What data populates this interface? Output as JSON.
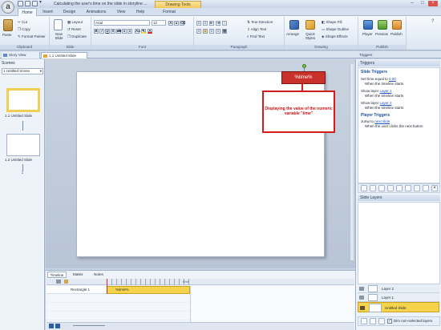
{
  "app": {
    "window_title": "Calculating the user's time on the slide in storyline ...",
    "context_tab": "Drawing Tools",
    "logo_letter": "a"
  },
  "ribbon": {
    "tabs": [
      "Home",
      "Insert",
      "Design",
      "Animations",
      "View",
      "Help",
      "Format"
    ],
    "active_tab": "Home",
    "clipboard": {
      "paste": "Paste",
      "cut": "Cut",
      "copy": "Copy",
      "format_painter": "Format Painter",
      "label": "Clipboard"
    },
    "slide": {
      "new_slide": "New Slide",
      "layout": "Layout",
      "reset": "Reset",
      "duplicate": "Duplicate",
      "label": "Slide"
    },
    "font": {
      "name": "Arial",
      "size": "12",
      "label": "Font"
    },
    "paragraph": {
      "text_direction": "Text Direction",
      "align_text": "Align Text",
      "find_text": "Find Text",
      "label": "Paragraph"
    },
    "drawing": {
      "arrange": "Arrange",
      "quick_styles": "Quick Styles",
      "shape_fill": "Shape Fill",
      "shape_outline": "Shape Outline",
      "shape_effects": "Shape Effects",
      "label": "Drawing"
    },
    "publish": {
      "player": "Player",
      "preview": "Preview",
      "publish": "Publish",
      "label": "Publish"
    }
  },
  "panes": {
    "story_view": "Story View",
    "current_tab": "1.1 Untitled Slide",
    "triggers": "Triggers",
    "slide_layers": "Slide Layers"
  },
  "scenes": {
    "label": "Scenes",
    "selected_scene": "1 Untitled Scene",
    "slides": [
      {
        "label": "1.1 Untitled Slide"
      },
      {
        "label": "1.2 Untitled Slide"
      }
    ]
  },
  "canvas": {
    "variable_box": "%time%",
    "callout": "Displaying the value of the numeric variable \"time\""
  },
  "triggers": {
    "slide_heading": "Slide Triggers",
    "items": [
      {
        "line1_pre": "Set time equal to ",
        "line1_link": "0.00",
        "line2": "When the timeline starts"
      },
      {
        "line1_pre": "Show layer ",
        "line1_link": "Layer 1",
        "line2": "When the timeline starts"
      },
      {
        "line1_pre": "Show layer ",
        "line1_link": "Layer 2",
        "line2": "When the timeline starts"
      }
    ],
    "player_heading": "Player Triggers",
    "player_items": [
      {
        "line1_pre": "Jump to ",
        "line1_link": "next slide",
        "line2": "When the user clicks the next button"
      }
    ]
  },
  "layers": {
    "items": [
      {
        "name": "Layer 2"
      },
      {
        "name": "Layer 1"
      },
      {
        "name": "Untitled Slide"
      }
    ],
    "dim_label": "Dim non-selected layers",
    "dim_checked": true
  },
  "timeline": {
    "tabs": [
      "Timeline",
      "States",
      "Notes"
    ],
    "row_name": "Rectangle 1",
    "row_bar": "%time%",
    "end_label": "End"
  },
  "colors": {
    "accent_red": "#c8322b",
    "callout_red": "#d31b1b",
    "selection_yellow": "#f5d34a"
  }
}
